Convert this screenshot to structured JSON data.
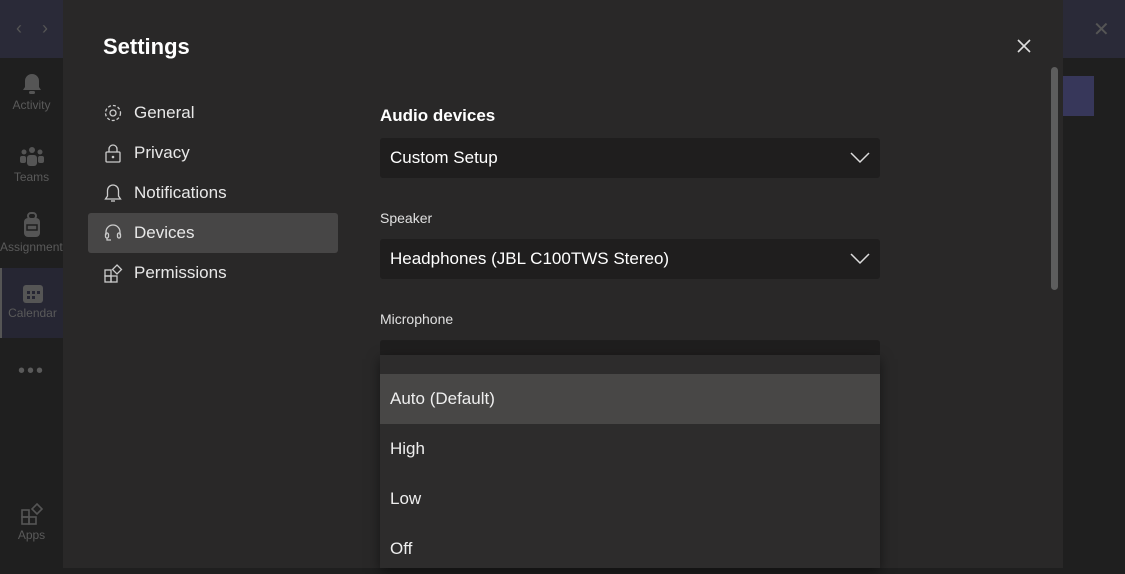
{
  "background_app": {
    "rail": [
      {
        "label": "Activity",
        "icon": "bell-icon"
      },
      {
        "label": "Teams",
        "icon": "teams-icon"
      },
      {
        "label": "Assignments",
        "icon": "backpack-icon"
      },
      {
        "label": "Calendar",
        "icon": "calendar-icon",
        "active": true
      },
      {
        "label": "",
        "icon": "more-icon"
      },
      {
        "label": "Apps",
        "icon": "apps-icon"
      }
    ]
  },
  "settings": {
    "title": "Settings",
    "menu": [
      {
        "label": "General",
        "icon": "gear-icon"
      },
      {
        "label": "Privacy",
        "icon": "lock-icon"
      },
      {
        "label": "Notifications",
        "icon": "bell-icon"
      },
      {
        "label": "Devices",
        "icon": "headset-icon",
        "selected": true
      },
      {
        "label": "Permissions",
        "icon": "apps-icon"
      }
    ],
    "devices": {
      "audio_devices_heading": "Audio devices",
      "audio_devices_value": "Custom Setup",
      "speaker_label": "Speaker",
      "speaker_value": "Headphones (JBL C100TWS Stereo)",
      "microphone_label": "Microphone",
      "dropdown_options": [
        "Auto (Default)",
        "High",
        "Low",
        "Off"
      ],
      "highlighted_option": "Auto (Default)"
    }
  },
  "colors": {
    "modal_bg": "#292828",
    "selected_bg": "#474646",
    "field_bg": "#1f1e1e"
  }
}
